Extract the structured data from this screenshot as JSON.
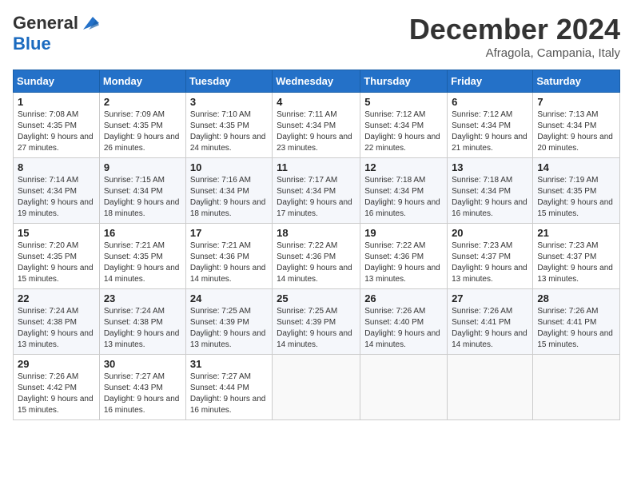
{
  "logo": {
    "general": "General",
    "blue": "Blue"
  },
  "title": "December 2024",
  "location": "Afragola, Campania, Italy",
  "weekdays": [
    "Sunday",
    "Monday",
    "Tuesday",
    "Wednesday",
    "Thursday",
    "Friday",
    "Saturday"
  ],
  "weeks": [
    [
      {
        "day": "1",
        "sunrise": "Sunrise: 7:08 AM",
        "sunset": "Sunset: 4:35 PM",
        "daylight": "Daylight: 9 hours and 27 minutes."
      },
      {
        "day": "2",
        "sunrise": "Sunrise: 7:09 AM",
        "sunset": "Sunset: 4:35 PM",
        "daylight": "Daylight: 9 hours and 26 minutes."
      },
      {
        "day": "3",
        "sunrise": "Sunrise: 7:10 AM",
        "sunset": "Sunset: 4:35 PM",
        "daylight": "Daylight: 9 hours and 24 minutes."
      },
      {
        "day": "4",
        "sunrise": "Sunrise: 7:11 AM",
        "sunset": "Sunset: 4:34 PM",
        "daylight": "Daylight: 9 hours and 23 minutes."
      },
      {
        "day": "5",
        "sunrise": "Sunrise: 7:12 AM",
        "sunset": "Sunset: 4:34 PM",
        "daylight": "Daylight: 9 hours and 22 minutes."
      },
      {
        "day": "6",
        "sunrise": "Sunrise: 7:12 AM",
        "sunset": "Sunset: 4:34 PM",
        "daylight": "Daylight: 9 hours and 21 minutes."
      },
      {
        "day": "7",
        "sunrise": "Sunrise: 7:13 AM",
        "sunset": "Sunset: 4:34 PM",
        "daylight": "Daylight: 9 hours and 20 minutes."
      }
    ],
    [
      {
        "day": "8",
        "sunrise": "Sunrise: 7:14 AM",
        "sunset": "Sunset: 4:34 PM",
        "daylight": "Daylight: 9 hours and 19 minutes."
      },
      {
        "day": "9",
        "sunrise": "Sunrise: 7:15 AM",
        "sunset": "Sunset: 4:34 PM",
        "daylight": "Daylight: 9 hours and 18 minutes."
      },
      {
        "day": "10",
        "sunrise": "Sunrise: 7:16 AM",
        "sunset": "Sunset: 4:34 PM",
        "daylight": "Daylight: 9 hours and 18 minutes."
      },
      {
        "day": "11",
        "sunrise": "Sunrise: 7:17 AM",
        "sunset": "Sunset: 4:34 PM",
        "daylight": "Daylight: 9 hours and 17 minutes."
      },
      {
        "day": "12",
        "sunrise": "Sunrise: 7:18 AM",
        "sunset": "Sunset: 4:34 PM",
        "daylight": "Daylight: 9 hours and 16 minutes."
      },
      {
        "day": "13",
        "sunrise": "Sunrise: 7:18 AM",
        "sunset": "Sunset: 4:34 PM",
        "daylight": "Daylight: 9 hours and 16 minutes."
      },
      {
        "day": "14",
        "sunrise": "Sunrise: 7:19 AM",
        "sunset": "Sunset: 4:35 PM",
        "daylight": "Daylight: 9 hours and 15 minutes."
      }
    ],
    [
      {
        "day": "15",
        "sunrise": "Sunrise: 7:20 AM",
        "sunset": "Sunset: 4:35 PM",
        "daylight": "Daylight: 9 hours and 15 minutes."
      },
      {
        "day": "16",
        "sunrise": "Sunrise: 7:21 AM",
        "sunset": "Sunset: 4:35 PM",
        "daylight": "Daylight: 9 hours and 14 minutes."
      },
      {
        "day": "17",
        "sunrise": "Sunrise: 7:21 AM",
        "sunset": "Sunset: 4:36 PM",
        "daylight": "Daylight: 9 hours and 14 minutes."
      },
      {
        "day": "18",
        "sunrise": "Sunrise: 7:22 AM",
        "sunset": "Sunset: 4:36 PM",
        "daylight": "Daylight: 9 hours and 14 minutes."
      },
      {
        "day": "19",
        "sunrise": "Sunrise: 7:22 AM",
        "sunset": "Sunset: 4:36 PM",
        "daylight": "Daylight: 9 hours and 13 minutes."
      },
      {
        "day": "20",
        "sunrise": "Sunrise: 7:23 AM",
        "sunset": "Sunset: 4:37 PM",
        "daylight": "Daylight: 9 hours and 13 minutes."
      },
      {
        "day": "21",
        "sunrise": "Sunrise: 7:23 AM",
        "sunset": "Sunset: 4:37 PM",
        "daylight": "Daylight: 9 hours and 13 minutes."
      }
    ],
    [
      {
        "day": "22",
        "sunrise": "Sunrise: 7:24 AM",
        "sunset": "Sunset: 4:38 PM",
        "daylight": "Daylight: 9 hours and 13 minutes."
      },
      {
        "day": "23",
        "sunrise": "Sunrise: 7:24 AM",
        "sunset": "Sunset: 4:38 PM",
        "daylight": "Daylight: 9 hours and 13 minutes."
      },
      {
        "day": "24",
        "sunrise": "Sunrise: 7:25 AM",
        "sunset": "Sunset: 4:39 PM",
        "daylight": "Daylight: 9 hours and 13 minutes."
      },
      {
        "day": "25",
        "sunrise": "Sunrise: 7:25 AM",
        "sunset": "Sunset: 4:39 PM",
        "daylight": "Daylight: 9 hours and 14 minutes."
      },
      {
        "day": "26",
        "sunrise": "Sunrise: 7:26 AM",
        "sunset": "Sunset: 4:40 PM",
        "daylight": "Daylight: 9 hours and 14 minutes."
      },
      {
        "day": "27",
        "sunrise": "Sunrise: 7:26 AM",
        "sunset": "Sunset: 4:41 PM",
        "daylight": "Daylight: 9 hours and 14 minutes."
      },
      {
        "day": "28",
        "sunrise": "Sunrise: 7:26 AM",
        "sunset": "Sunset: 4:41 PM",
        "daylight": "Daylight: 9 hours and 15 minutes."
      }
    ],
    [
      {
        "day": "29",
        "sunrise": "Sunrise: 7:26 AM",
        "sunset": "Sunset: 4:42 PM",
        "daylight": "Daylight: 9 hours and 15 minutes."
      },
      {
        "day": "30",
        "sunrise": "Sunrise: 7:27 AM",
        "sunset": "Sunset: 4:43 PM",
        "daylight": "Daylight: 9 hours and 16 minutes."
      },
      {
        "day": "31",
        "sunrise": "Sunrise: 7:27 AM",
        "sunset": "Sunset: 4:44 PM",
        "daylight": "Daylight: 9 hours and 16 minutes."
      },
      null,
      null,
      null,
      null
    ]
  ]
}
